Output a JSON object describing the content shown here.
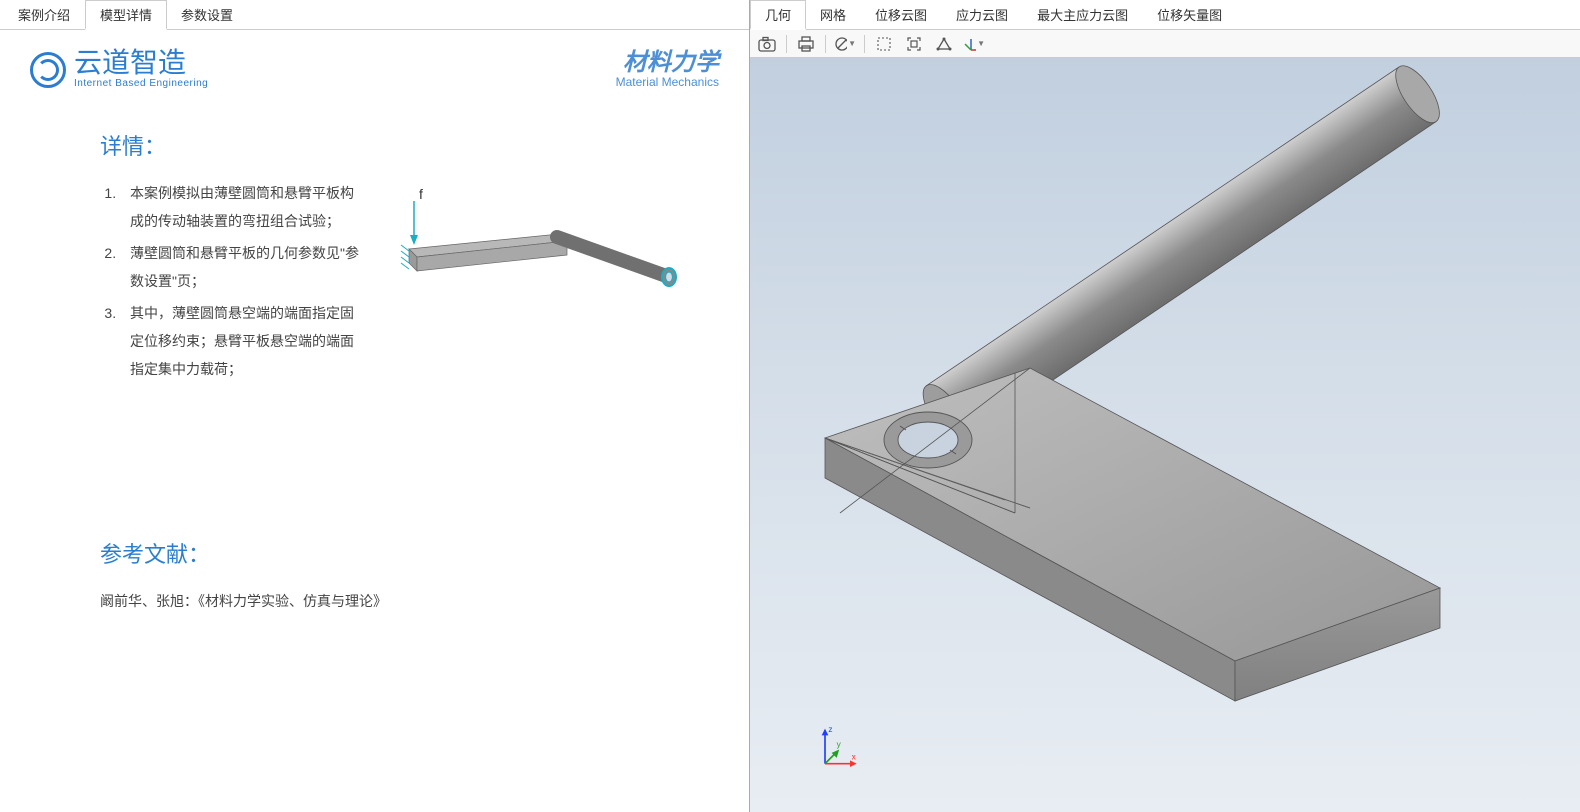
{
  "left_tabs": {
    "items": [
      {
        "label": "案例介绍"
      },
      {
        "label": "模型详情"
      },
      {
        "label": "参数设置"
      }
    ],
    "active_index": 1
  },
  "right_tabs": {
    "items": [
      {
        "label": "几何"
      },
      {
        "label": "网格"
      },
      {
        "label": "位移云图"
      },
      {
        "label": "应力云图"
      },
      {
        "label": "最大主应力云图"
      },
      {
        "label": "位移矢量图"
      }
    ],
    "active_index": 0
  },
  "brand": {
    "main": "云道智造",
    "sub": "Internet Based Engineering",
    "right_main": "材料力学",
    "right_sub": "Material Mechanics"
  },
  "details": {
    "title": "详情：",
    "items": [
      "本案例模拟由薄壁圆筒和悬臂平板构成的传动轴装置的弯扭组合试验；",
      "薄壁圆筒和悬臂平板的几何参数见\"参数设置\"页；",
      "其中，薄壁圆筒悬空端的端面指定固定位移约束；悬臂平板悬空端的端面指定集中力载荷；"
    ],
    "force_label": "f"
  },
  "references": {
    "title": "参考文献：",
    "text": "阚前华、张旭：《材料力学实验、仿真与理论》"
  },
  "toolbar": {
    "icons": [
      "camera-icon",
      "print-icon",
      "circle-slash-icon",
      "select-box-icon",
      "fit-view-icon",
      "surface-edge-icon",
      "axis-icon"
    ]
  },
  "axes": {
    "x": "x",
    "y": "y",
    "z": "z"
  }
}
